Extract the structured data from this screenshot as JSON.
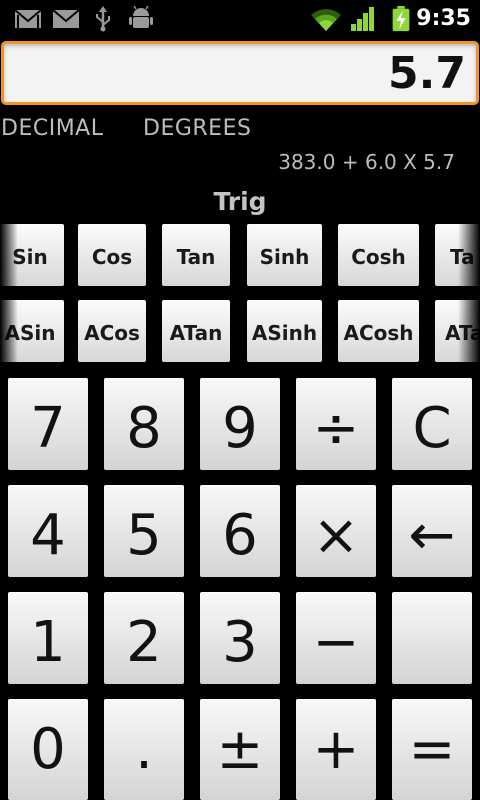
{
  "status_bar": {
    "clock": "9:35",
    "icons": [
      "gmail-icon",
      "mail-icon",
      "usb-icon",
      "android-debug-icon",
      "wifi-icon",
      "signal-icon",
      "battery-charging-icon"
    ]
  },
  "display": {
    "value": "5.7"
  },
  "mode": {
    "base": "DECIMAL",
    "angle": "DEGREES"
  },
  "expression": "383.0 + 6.0 X 5.7",
  "panel": {
    "title": "Trig",
    "row1": [
      "Sin",
      "Cos",
      "Tan",
      "Sinh",
      "Cosh",
      "Ta"
    ],
    "row2": [
      "ASin",
      "ACos",
      "ATan",
      "ASinh",
      "ACosh",
      "ATa"
    ]
  },
  "keypad": {
    "row1": [
      "7",
      "8",
      "9",
      "÷",
      "C"
    ],
    "row2": [
      "4",
      "5",
      "6",
      "×",
      "←"
    ],
    "row3": [
      "1",
      "2",
      "3",
      "−",
      ""
    ],
    "row4": [
      "0",
      ".",
      "±",
      "+",
      "="
    ]
  },
  "colors": {
    "accent": "#f0961e",
    "key_top": "#f8f8f8",
    "key_bottom": "#d4d4d4"
  }
}
